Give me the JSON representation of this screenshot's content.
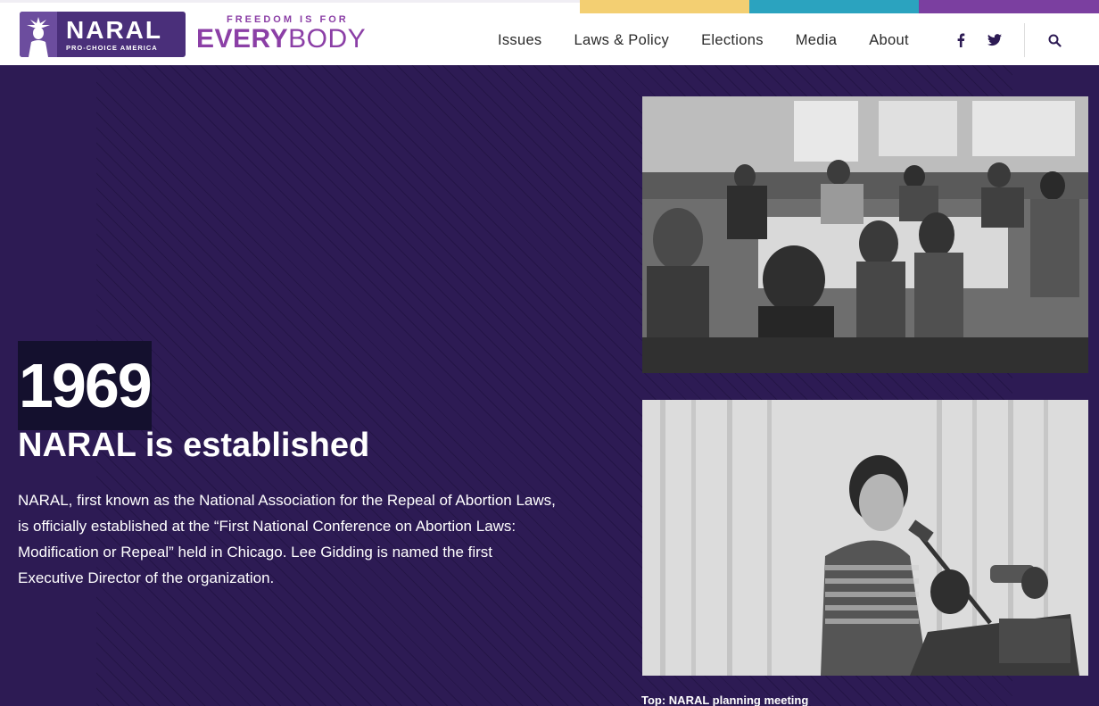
{
  "brand": {
    "name": "NARAL",
    "subtitle": "PRO-CHOICE AMERICA",
    "tagline_top": "FREEDOM IS FOR",
    "tagline_main_bold": "EVERY",
    "tagline_main_rest": "BODY"
  },
  "nav": {
    "items": [
      {
        "label": "Issues"
      },
      {
        "label": "Laws & Policy"
      },
      {
        "label": "Elections"
      },
      {
        "label": "Media"
      },
      {
        "label": "About"
      }
    ],
    "icons": [
      "facebook-icon",
      "twitter-icon",
      "search-icon"
    ]
  },
  "colors": {
    "stripe_yellow": "#f3cf72",
    "stripe_teal": "#2ba3bf",
    "stripe_purple": "#7b3fa0",
    "page_background": "#2d1b54",
    "brand_purple": "#8b3fa6"
  },
  "timeline": {
    "year": "1969",
    "title": "NARAL is established",
    "description": "NARAL, first known as the National Association for the Repeal of Abortion Laws, is officially established at the “First National Conference on Abortion Laws: Modification or Repeal” held in Chicago. Lee Gidding is named the first Executive Director of the organization."
  },
  "photos": {
    "caption": "Top: NARAL planning meeting"
  }
}
